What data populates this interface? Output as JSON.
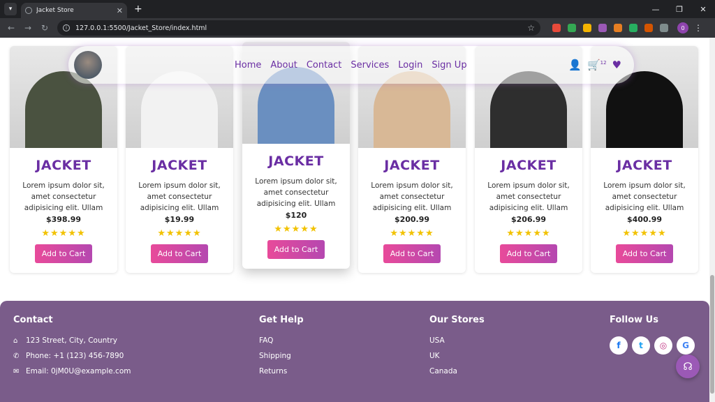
{
  "browser": {
    "tab_title": "Jacket Store",
    "url": "127.0.0.1:5500/Jacket_Store/index.html",
    "profile_initial": "0"
  },
  "nav": {
    "links": [
      "Home",
      "About",
      "Contact",
      "Services",
      "Login",
      "Sign Up"
    ],
    "cart_badge": "12"
  },
  "products": [
    {
      "name": "JACKET",
      "desc": "Lorem ipsum dolor sit, amet consectetur adipisicing elit. Ullam",
      "price": "$398.99",
      "stars": "★★★★★",
      "button": "Add to Cart",
      "color": "#4a5240"
    },
    {
      "name": "JACKET",
      "desc": "Lorem ipsum dolor sit, amet consectetur adipisicing elit. Ullam",
      "price": "$19.99",
      "stars": "★★★★★",
      "button": "Add to Cart",
      "color": "#f2f2f2"
    },
    {
      "name": "JACKET",
      "desc": "Lorem ipsum dolor sit, amet consectetur adipisicing elit. Ullam",
      "price": "$120",
      "stars": "★★★★★",
      "button": "Add to Cart",
      "color": "#6a8fc0"
    },
    {
      "name": "JACKET",
      "desc": "Lorem ipsum dolor sit, amet consectetur adipisicing elit. Ullam",
      "price": "$200.99",
      "stars": "★★★★★",
      "button": "Add to Cart",
      "color": "#d8b896"
    },
    {
      "name": "JACKET",
      "desc": "Lorem ipsum dolor sit, amet consectetur adipisicing elit. Ullam",
      "price": "$206.99",
      "stars": "★★★★★",
      "button": "Add to Cart",
      "color": "#2e2e2e"
    },
    {
      "name": "JACKET",
      "desc": "Lorem ipsum dolor sit, amet consectetur adipisicing elit. Ullam",
      "price": "$400.99",
      "stars": "★★★★★",
      "button": "Add to Cart",
      "color": "#111111"
    }
  ],
  "footer": {
    "contact": {
      "heading": "Contact",
      "address": "123 Street, City, Country",
      "phone": "Phone: +1 (123) 456-7890",
      "email": "Email: 0jM0U@example.com"
    },
    "help": {
      "heading": "Get Help",
      "items": [
        "FAQ",
        "Shipping",
        "Returns"
      ]
    },
    "stores": {
      "heading": "Our Stores",
      "items": [
        "USA",
        "UK",
        "Canada"
      ]
    },
    "follow": {
      "heading": "Follow Us"
    }
  }
}
